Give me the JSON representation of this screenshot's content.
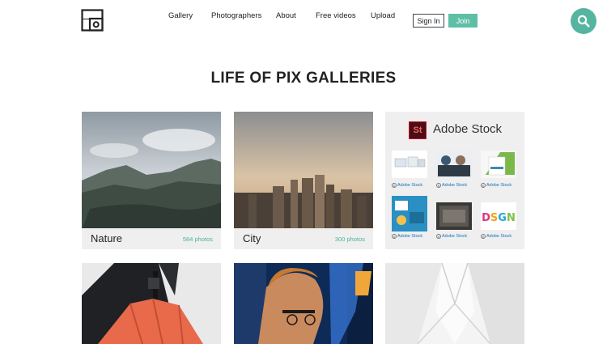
{
  "nav": {
    "items": [
      "Gallery",
      "Photographers",
      "About",
      "Free videos",
      "Upload"
    ],
    "sign_in": "Sign In",
    "join": "Join",
    "accent": "#5fbfa6"
  },
  "page": {
    "title": "LIFE OF PIX GALLERIES"
  },
  "galleries": [
    {
      "name": "Nature",
      "count": "584 photos"
    },
    {
      "name": "City",
      "count": "300 photos"
    }
  ],
  "adobe": {
    "logo_text": "St",
    "title": "Adobe Stock",
    "thumb_label": "Adobe Stock",
    "thumb_icon": "$"
  },
  "icons": {
    "logo": "life-of-pix-logo-icon",
    "search": "search-icon"
  }
}
